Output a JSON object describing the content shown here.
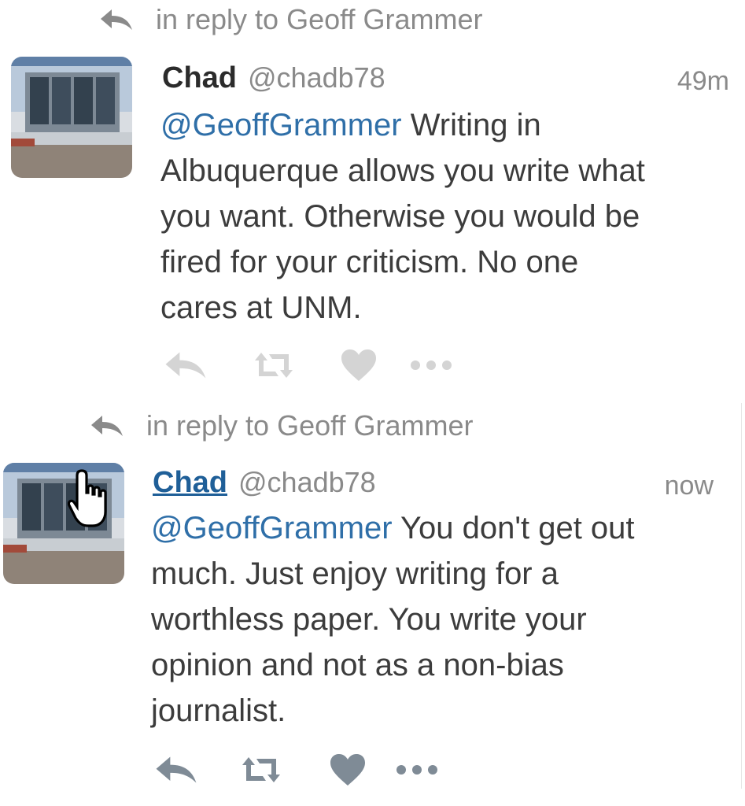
{
  "tweets": [
    {
      "reply_context": "in reply to Geoff Grammer",
      "name": "Chad",
      "handle": "@chadb78",
      "time": "49m",
      "mention": "@GeoffGrammer",
      "body_lines": [
        " Writing in",
        "Albuquerque allows you write what",
        "you want. Otherwise you would be",
        "fired for your criticism. No one",
        "cares at UNM."
      ]
    },
    {
      "reply_context": "in reply to Geoff Grammer",
      "name": "Chad",
      "handle": "@chadb78",
      "time": "now",
      "mention": "@GeoffGrammer",
      "body_lines": [
        " You don't get out",
        "much. Just enjoy writing for a",
        "worthless paper. You write your",
        "opinion and not as a non-bias",
        "journalist."
      ]
    }
  ],
  "icons": {
    "reply": "reply-arrow-icon",
    "retweet": "retweet-icon",
    "like": "heart-icon",
    "more": "more-dots-icon",
    "cursor": "hand-pointer-cursor-icon"
  },
  "colors": {
    "mention": "#2f6fa8",
    "name_link": "#1f5f98",
    "muted": "#8a8a8a",
    "action_faded": "#d4d4d4",
    "action_active": "#7f8b96"
  }
}
